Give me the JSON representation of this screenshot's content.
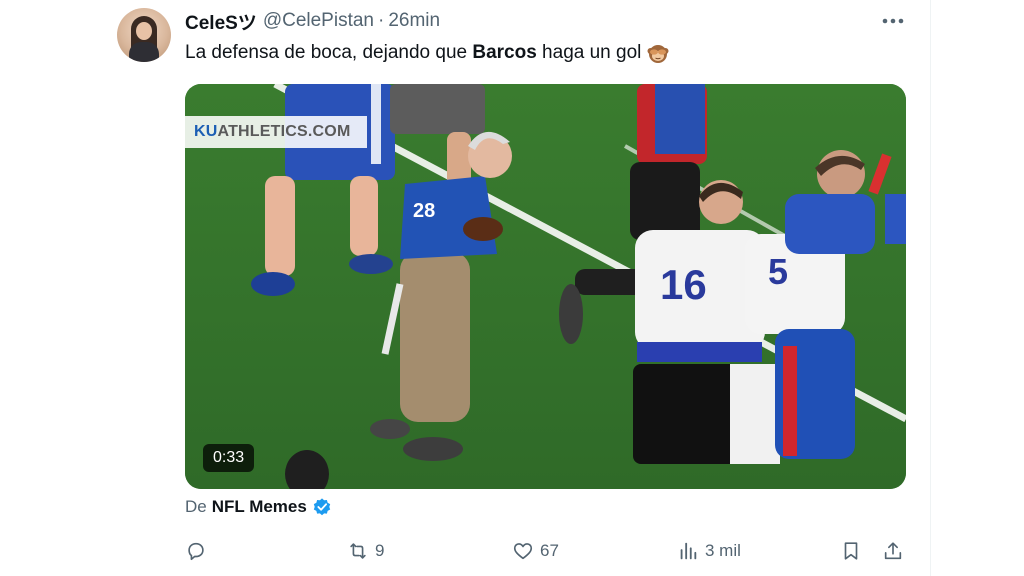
{
  "tweet": {
    "author": {
      "display_name": "CeleSツ",
      "handle": "@CelePistan",
      "avatar_icon": "profile-avatar"
    },
    "separator": "·",
    "time": "26min",
    "text": {
      "part1": "La defensa de boca, dejando que ",
      "bold": "Barcos",
      "part2": " haga un gol",
      "emoji": "see-no-evil-monkey-icon"
    },
    "media": {
      "watermark_part1": "KU",
      "watermark_part2": "ATHLETICS.COM",
      "duration": "0:33"
    },
    "attribution": {
      "prefix": "De",
      "source": "NFL Memes",
      "verified_icon": "verified-badge-icon"
    },
    "actions": {
      "reply": {
        "icon": "reply-icon",
        "count": ""
      },
      "retweet": {
        "icon": "retweet-icon",
        "count": "9"
      },
      "like": {
        "icon": "heart-icon",
        "count": "67"
      },
      "views": {
        "icon": "views-icon",
        "count": "3 mil"
      },
      "bookmark": {
        "icon": "bookmark-icon"
      },
      "share": {
        "icon": "share-icon"
      }
    }
  },
  "colors": {
    "text": "#0f1419",
    "secondary": "#536471",
    "verified": "#1d9bf0",
    "field": "#3c7b32"
  }
}
